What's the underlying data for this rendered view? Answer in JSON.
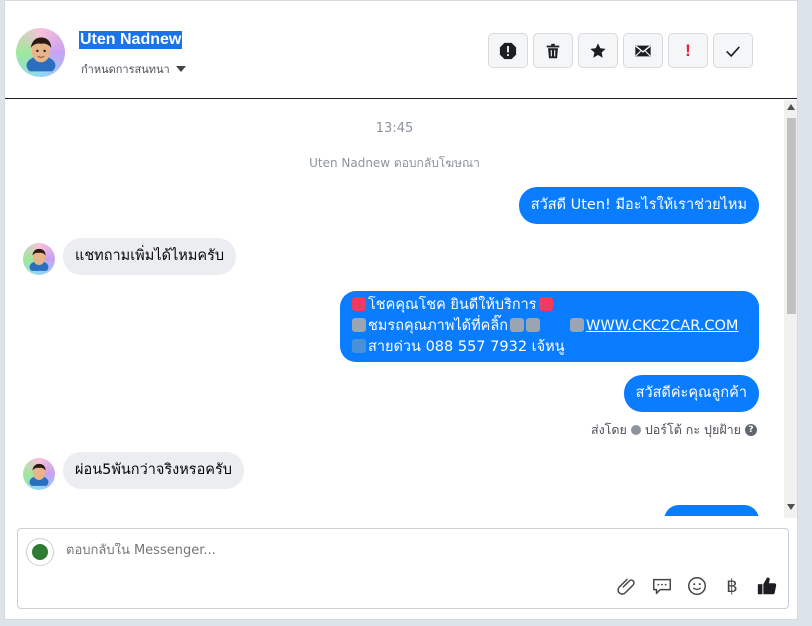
{
  "header": {
    "name": "Uten Nadnew",
    "subtitle": "กำหนดการสนทนา",
    "toolbar": [
      {
        "icon": "alert-icon"
      },
      {
        "icon": "trash-icon"
      },
      {
        "icon": "star-icon"
      },
      {
        "icon": "mail-icon"
      },
      {
        "icon": "spam-icon",
        "label": "!"
      },
      {
        "icon": "check-icon"
      }
    ]
  },
  "messages": {
    "time": "13:45",
    "notice": "Uten Nadnew ตอบกลับโฆษณา",
    "out_1": "สวัสดี Uten! มีอะไรให้เราช่วยไหม",
    "in_1": "แชทถามเพิ่มได้ไหมครับ",
    "out_2": {
      "line1": "โชคคุณโชค ยินดีให้บริการ",
      "line2": "ชมรถคุณภาพได้ที่คลิ๊ก",
      "link": "WWW.CKC2CAR.COM",
      "line3": "สายด่วน 088 557 7932 เจ้หนู"
    },
    "out_3": "สวัสดีค่ะคุณลูกค้า",
    "sent_by_label": "ส่งโดย",
    "sent_by_name": "ปอร์โต้ กะ ปุยฝ้าย",
    "in_2": "ผ่อน5พันกว่าจริงหรอครับ"
  },
  "composer": {
    "placeholder": "ตอบกลับใน Messenger...",
    "icons": [
      "attachment-icon",
      "quick-reply-icon",
      "emoji-icon",
      "baht-icon",
      "thumbs-up-icon"
    ],
    "baht_symbol": "฿"
  },
  "colors": {
    "outgoing": "#0a7cff",
    "incoming": "#ebedf0",
    "name_highlight": "#1a73e8"
  }
}
